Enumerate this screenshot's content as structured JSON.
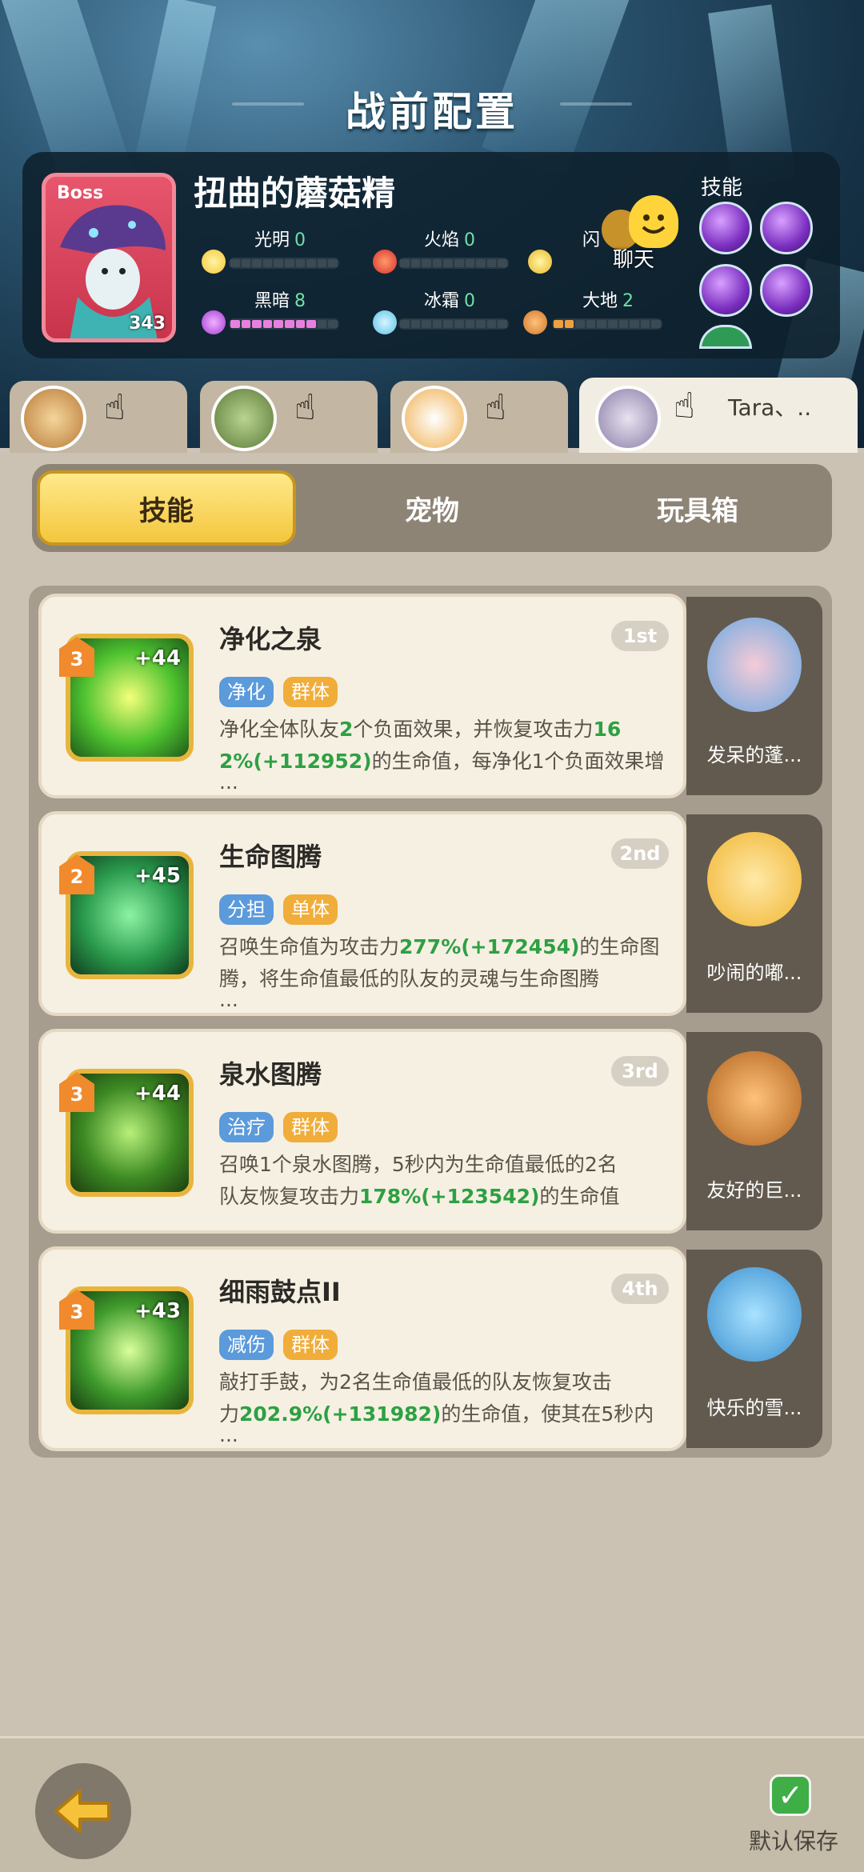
{
  "header": {
    "title": "战前配置"
  },
  "boss": {
    "label": "Boss",
    "name": "扭曲的蘑菇精",
    "level": "343",
    "elements": [
      {
        "name": "光明",
        "value": "0",
        "fill": 0
      },
      {
        "name": "火焰",
        "value": "0",
        "fill": 0
      },
      {
        "name": "闪",
        "value": "",
        "fill": 0
      },
      {
        "name": "黑暗",
        "value": "8",
        "fill": 8
      },
      {
        "name": "冰霜",
        "value": "0",
        "fill": 0
      },
      {
        "name": "大地",
        "value": "2",
        "fill": 2
      }
    ],
    "skills_label": "技能"
  },
  "chat": {
    "label": "聊天"
  },
  "party": {
    "active_name": "Tara、.."
  },
  "tabs": [
    "技能",
    "宠物",
    "玩具箱"
  ],
  "skills": [
    {
      "level": "3",
      "plus": "+44",
      "title": "净化之泉",
      "rank": "1st",
      "tags": [
        "净化",
        "群体"
      ],
      "desc_1a": "净化全体队友",
      "desc_1b": "2",
      "desc_1c": "个负面效果，并恢复攻击力",
      "desc_1d": "16",
      "desc_2a": "2%(+112952)",
      "desc_2b": "的生命值，每净化1个负面效果增",
      "desc_3": "...",
      "pet": "发呆的蓬..."
    },
    {
      "level": "2",
      "plus": "+45",
      "title": "生命图腾",
      "rank": "2nd",
      "tags": [
        "分担",
        "单体"
      ],
      "desc_1a": "召唤生命值为攻击力",
      "desc_1b": "277%(+172454)",
      "desc_1c": "的生命图",
      "desc_2a": "腾，将生命值最低的队友的灵魂与生命图腾",
      "desc_3": "...",
      "pet": "吵闹的嘟..."
    },
    {
      "level": "3",
      "plus": "+44",
      "title": "泉水图腾",
      "rank": "3rd",
      "tags": [
        "治疗",
        "群体"
      ],
      "desc_1a": "召唤1个泉水图腾，5秒内为生命值最低的2名",
      "desc_2a": "队友恢复攻击力",
      "desc_2b": "178%(+123542)",
      "desc_2c": "的生命值",
      "pet": "友好的巨..."
    },
    {
      "level": "3",
      "plus": "+43",
      "title": "细雨鼓点II",
      "rank": "4th",
      "tags": [
        "减伤",
        "群体"
      ],
      "desc_1a": "敲打手鼓，为2名生命值最低的队友恢复攻击",
      "desc_2a": "力",
      "desc_2b": "202.9%(+131982)",
      "desc_2c": "的生命值，使其在5秒内",
      "desc_3": "...",
      "pet": "快乐的雪..."
    }
  ],
  "footer": {
    "save_label": "默认保存"
  },
  "colors": {
    "accent": "#f4c63e",
    "card_bg": "#f6f0e3",
    "green_value": "#2ea043",
    "tag_blue": "#5b9adb",
    "tag_orange": "#f0ad3a"
  }
}
